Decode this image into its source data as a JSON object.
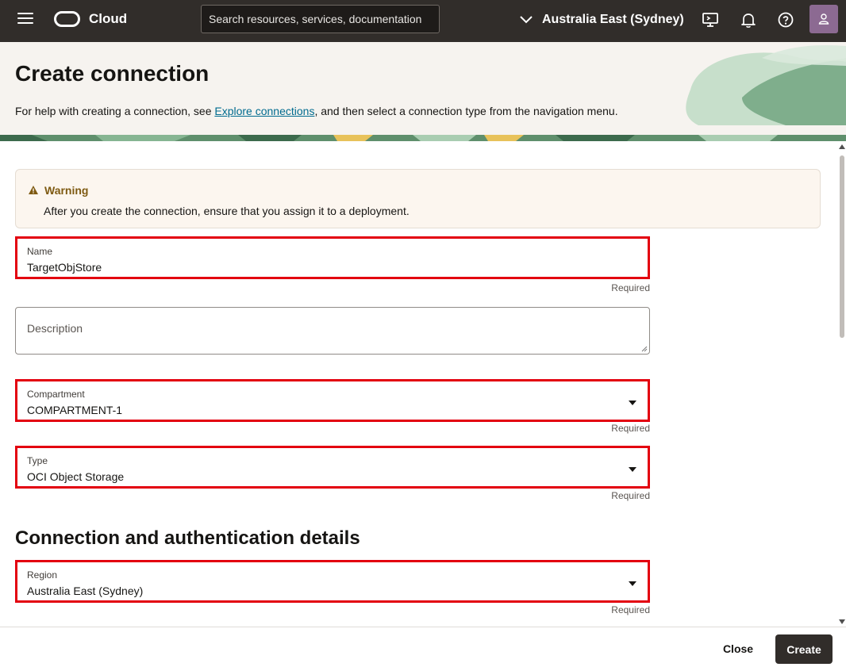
{
  "topbar": {
    "brand": "Cloud",
    "search_placeholder": "Search resources, services, documentation",
    "region": "Australia East (Sydney)"
  },
  "header": {
    "title": "Create connection",
    "help_prefix": "For help with creating a connection, see ",
    "help_link": "Explore connections",
    "help_suffix": ", and then select a connection type from the navigation menu."
  },
  "warning": {
    "title": "Warning",
    "text": "After you create the connection, ensure that you assign it to a deployment."
  },
  "form": {
    "name": {
      "label": "Name",
      "value": "TargetObjStore",
      "required": "Required"
    },
    "description": {
      "placeholder": "Description"
    },
    "compartment": {
      "label": "Compartment",
      "value": "COMPARTMENT-1",
      "required": "Required"
    },
    "type": {
      "label": "Type",
      "value": "OCI Object Storage",
      "required": "Required"
    },
    "section_title": "Connection and authentication details",
    "region": {
      "label": "Region",
      "value": "Australia East (Sydney)",
      "required": "Required"
    }
  },
  "footer": {
    "close_label": "Close",
    "create_label": "Create"
  },
  "colors": {
    "topbar": "#312d2a",
    "highlight": "#e3000f",
    "link": "#006b8f",
    "warning_bg": "#fcf6ef"
  }
}
